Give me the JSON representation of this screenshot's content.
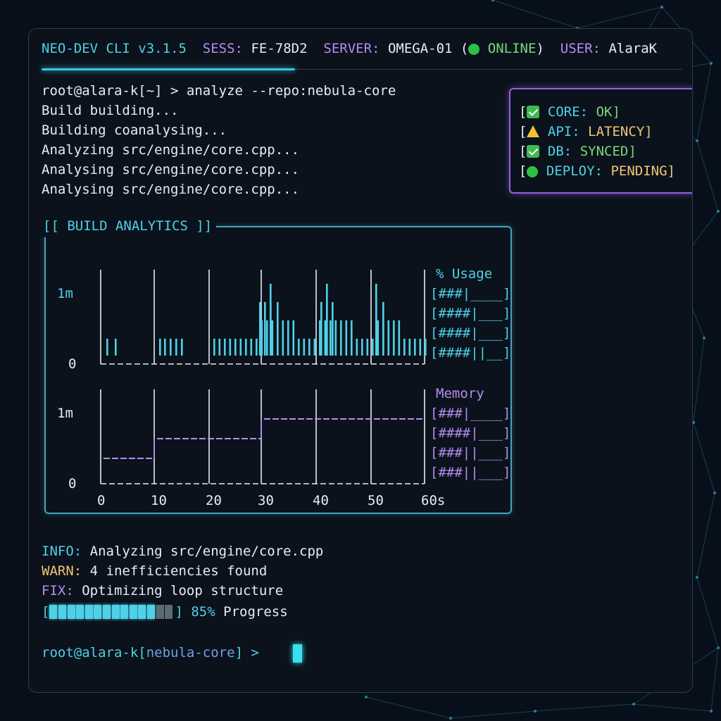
{
  "header": {
    "app_name": "NEO-DEV CLI v3.1.5",
    "sess_label": "SESS:",
    "sess_value": "FE-78D2",
    "server_label": "SERVER:",
    "server_value": "OMEGA-01 (",
    "server_status": "ONLINE",
    "server_close": ")",
    "user_label": "USER:",
    "user_value": "AlaraK"
  },
  "log": {
    "prompt": "root@alara-k[~] > analyze --repo:nebula-core",
    "lines": [
      "Build building...",
      "Building coanalysing...",
      "Analyzing src/engine/core.cpp...",
      "Analysing src/engine/core.cpp...",
      "Analysing src/engine/core.cpp..."
    ]
  },
  "status": [
    {
      "icon": "check-icon",
      "label": "CORE:",
      "value": "OK]",
      "value_color": "#7fd67a"
    },
    {
      "icon": "warning-icon",
      "label": "API:",
      "value": "LATENCY]",
      "value_color": "#f0c674"
    },
    {
      "icon": "check-icon",
      "label": "DB:",
      "value": "SYNCED]",
      "value_color": "#7fd67a"
    },
    {
      "icon": "green-dot-icon",
      "label": "DEPLOY:",
      "value": "PENDING]",
      "value_color": "#f0c674"
    }
  ],
  "chart_data": {
    "type": "bar",
    "title": "[[ BUILD ANALYTICS ]]",
    "x_ticks": [
      "0",
      "10",
      "20",
      "30",
      "40",
      "50",
      "60s"
    ],
    "panels": [
      {
        "name": "% Usage",
        "y_ticks": [
          "1m",
          "0"
        ],
        "color": "#4fd1e8",
        "legend_rows": [
          "[###|____]",
          "[####|___]",
          "[####|___]",
          "[####||__]"
        ]
      },
      {
        "name": "Memory",
        "y_ticks": [
          "1m",
          "0"
        ],
        "color": "#b48df0",
        "legend_rows": [
          "[###|____]",
          "[####|___]",
          "[###||___]",
          "[###||___]"
        ]
      }
    ]
  },
  "messages": [
    {
      "tag": "INFO:",
      "text": " Analyzing src/engine/core.cpp",
      "color": "#4fd1e8"
    },
    {
      "tag": "WARN:",
      "text": " 4 inefficiencies found",
      "color": "#f0c674"
    },
    {
      "tag": "FIX:",
      "text": " Optimizing loop structure",
      "color": "#b48df0"
    }
  ],
  "progress": {
    "value": 0.85,
    "label": "85%",
    "suffix": " Progress"
  },
  "prompt2": {
    "user": "root@alara-k[",
    "dir": "nebula-core",
    "tail": "] >"
  },
  "colors": {
    "accent": "#4fd1e8",
    "purple": "#b48df0",
    "yellow": "#f0c674",
    "green": "#7fd67a"
  }
}
